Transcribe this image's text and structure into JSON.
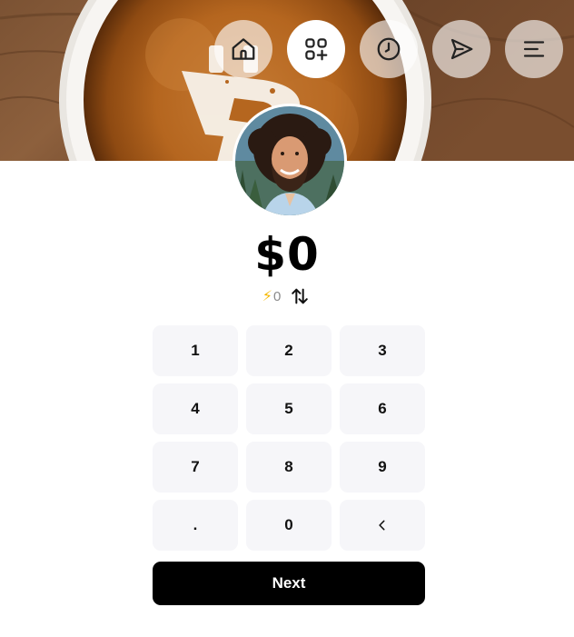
{
  "header": {
    "banner_image": "coffee-cup-with-bitcoin-latte-art",
    "nav": [
      {
        "name": "home",
        "icon": "home-icon",
        "active": false
      },
      {
        "name": "apps",
        "icon": "apps-plus-icon",
        "active": true
      },
      {
        "name": "history",
        "icon": "clock-icon",
        "active": false
      },
      {
        "name": "send",
        "icon": "send-icon",
        "active": false
      },
      {
        "name": "menu",
        "icon": "menu-icon",
        "active": false
      }
    ]
  },
  "profile": {
    "avatar": "user-avatar-photo"
  },
  "amount": {
    "display": "$0",
    "sats_symbol": "⚡",
    "sats_value": "0",
    "swap_icon": "swap-arrows-icon"
  },
  "keypad": {
    "keys": [
      "1",
      "2",
      "3",
      "4",
      "5",
      "6",
      "7",
      "8",
      "9",
      ".",
      "0",
      "<"
    ]
  },
  "actions": {
    "next_label": "Next"
  },
  "colors": {
    "key_bg": "#f6f6f9",
    "button_bg": "#000000",
    "bolt": "#f5b800"
  }
}
